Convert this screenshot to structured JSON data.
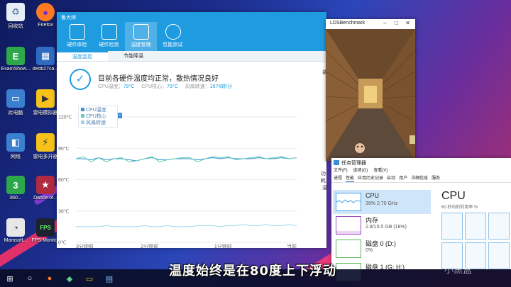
{
  "desktop": {
    "icons": [
      {
        "label": "回收站",
        "icon": "recycle-bin-icon"
      },
      {
        "label": "Firefox",
        "icon": "firefox-icon"
      },
      {
        "label": "ExamShow...",
        "icon": "examshow-icon"
      },
      {
        "label": "dedb27ca...",
        "icon": "app-icon"
      },
      {
        "label": "此电脑",
        "icon": "this-pc-icon"
      },
      {
        "label": "雷电模拟器",
        "icon": "ldplayer-icon"
      },
      {
        "label": "网络",
        "icon": "network-icon"
      },
      {
        "label": "雷电多开器",
        "icon": "ldmulti-icon"
      },
      {
        "label": "360...",
        "icon": "360-icon"
      },
      {
        "label": "Dance of...",
        "icon": "game-icon"
      },
      {
        "label": "Mamsoft...",
        "icon": "mamsoft-icon"
      },
      {
        "label": "FPS Monitor",
        "icon": "fps-monitor-icon"
      }
    ]
  },
  "ludashi": {
    "title": "鲁大师",
    "nav": [
      {
        "label": "硬件体检",
        "active": false
      },
      {
        "label": "硬件检测",
        "active": false
      },
      {
        "label": "温度管理",
        "active": true
      },
      {
        "label": "性能测试",
        "active": false
      }
    ],
    "subtabs": [
      {
        "label": "温度监控",
        "active": true
      },
      {
        "label": "节能降温",
        "active": false
      }
    ],
    "status": {
      "title": "目前各硬件温度均正常，散热情况良好",
      "metrics": [
        {
          "label": "CPU温度：",
          "value": "79°C"
        },
        {
          "label": "CPU核心：",
          "value": "79°C"
        },
        {
          "label": "风扇转速：",
          "value": "1674转/分"
        }
      ]
    },
    "side_labels": [
      "装",
      "功耗",
      "温"
    ]
  },
  "chart_data": {
    "type": "line",
    "title": "",
    "xlabel": "",
    "ylabel": "",
    "x_tick_labels": [
      "3分钟前",
      "2分钟前",
      "1分钟前",
      "当前"
    ],
    "y_tick_labels": [
      "120℃",
      "90℃",
      "60℃",
      "30℃",
      "0℃"
    ],
    "ylim": [
      0,
      120
    ],
    "grid": true,
    "legend_placement": "top-left",
    "series": [
      {
        "name": "CPU温度",
        "color": "#3b8fd6",
        "values": [
          80,
          80,
          79,
          81,
          79,
          80,
          80,
          79,
          78,
          80,
          81,
          79,
          79,
          80,
          80,
          80,
          79,
          80,
          81,
          80,
          81,
          80,
          80,
          80,
          81,
          80,
          80,
          81,
          80,
          81
        ]
      },
      {
        "name": "CPU核心",
        "color": "#5fcfb6",
        "values": [
          80,
          82,
          77,
          81,
          77,
          80,
          81,
          77,
          78,
          80,
          82,
          77,
          79,
          80,
          81,
          81,
          77,
          80,
          82,
          81,
          82,
          79,
          80,
          81,
          82,
          80,
          81,
          82,
          80,
          81
        ]
      },
      {
        "name": "风扇转速",
        "color": "#9fd3ee",
        "values": [
          15,
          15,
          15,
          15,
          16,
          15,
          15,
          15,
          15,
          16,
          15,
          15,
          16,
          15,
          15,
          15,
          16,
          16,
          16,
          15,
          16,
          16,
          17,
          16,
          16,
          17,
          16,
          16,
          17,
          16
        ]
      }
    ]
  },
  "lds": {
    "title": "LDSBenchmark"
  },
  "taskmgr": {
    "title": "任务管理器",
    "menu": [
      "文件(F)",
      "选项(O)",
      "查看(V)"
    ],
    "tabs": [
      {
        "label": "进程",
        "active": false
      },
      {
        "label": "性能",
        "active": true
      },
      {
        "label": "应用历史记录",
        "active": false
      },
      {
        "label": "启动",
        "active": false
      },
      {
        "label": "用户",
        "active": false
      },
      {
        "label": "详细信息",
        "active": false
      },
      {
        "label": "服务",
        "active": false
      }
    ],
    "resources": [
      {
        "name": "CPU",
        "sub": "39% 2.70 GHz",
        "selected": true,
        "color": "#4aa0e6"
      },
      {
        "name": "内存",
        "sub": "2.8/15.5 GB (18%)",
        "selected": false,
        "color": "#a050c0"
      },
      {
        "name": "磁盘 0 (D:)",
        "sub": "0%",
        "selected": false,
        "color": "#5cb85c"
      },
      {
        "name": "磁盘 1 (G: H:)",
        "sub": "0%",
        "selected": false,
        "color": "#5cb85c"
      }
    ],
    "detail_title": "CPU",
    "detail_sub": "60 秒内的利用率 %"
  },
  "caption": "温度始终是在80度上下浮动",
  "watermark": "小黑盒"
}
